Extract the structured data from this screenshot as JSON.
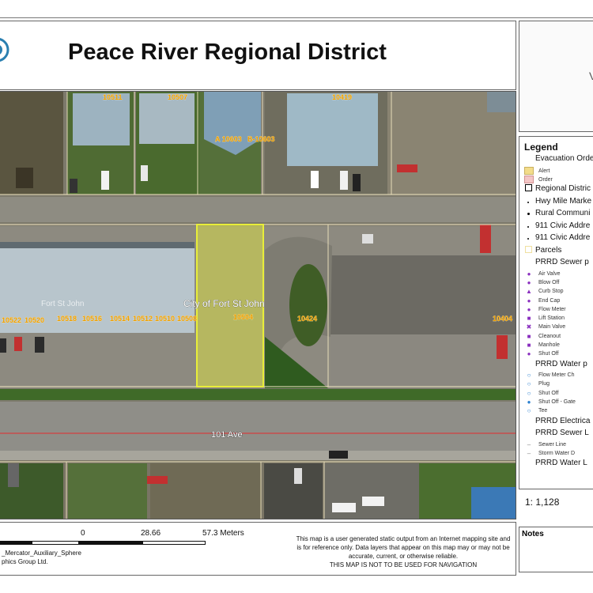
{
  "title": "Peace River Regional District",
  "map": {
    "street_label": "101 Ave",
    "place_label": "City of Fort St John",
    "faint_label": "Fort St John",
    "addresses": [
      "10511",
      "10507",
      "A 10603",
      "B-10603",
      "10419",
      "10522",
      "10520",
      "10518",
      "10516",
      "10514",
      "10512",
      "10510",
      "10508",
      "10504",
      "10424",
      "10404"
    ],
    "highlight_color": "#e8ee3a"
  },
  "legend": {
    "title": "Legend",
    "items": [
      {
        "label": "Evacuation Orde",
        "level": "header"
      },
      {
        "label": "Alert",
        "level": "sub",
        "symbol": "swatch-alert"
      },
      {
        "label": "Order",
        "level": "sub",
        "symbol": "swatch-order"
      },
      {
        "label": "Regional Distric",
        "level": "header",
        "symbol": "box-outline"
      },
      {
        "label": "Hwy Mile Marke",
        "level": "header",
        "symbol": "dot-small"
      },
      {
        "label": "Rural Communi",
        "level": "header",
        "symbol": "dot"
      },
      {
        "label": "911 Civic Addre",
        "level": "header",
        "symbol": "dot-small"
      },
      {
        "label": "911 Civic Addre",
        "level": "header",
        "symbol": "dot-small"
      },
      {
        "label": "Parcels",
        "level": "header",
        "symbol": "box-faint"
      },
      {
        "label": "PRRD Sewer p",
        "level": "header"
      },
      {
        "label": "Air Valve",
        "level": "sub",
        "symbol": "purple-dot"
      },
      {
        "label": "Blow Off",
        "level": "sub",
        "symbol": "purple-dot"
      },
      {
        "label": "Curb Stop",
        "level": "sub",
        "symbol": "purple-triangle"
      },
      {
        "label": "End Cap",
        "level": "sub",
        "symbol": "purple-dot"
      },
      {
        "label": "Flow Meter",
        "level": "sub",
        "symbol": "purple-dot"
      },
      {
        "label": "Lift Station",
        "level": "sub",
        "symbol": "purple-square"
      },
      {
        "label": "Main Valve",
        "level": "sub",
        "symbol": "purple-x"
      },
      {
        "label": "Cleanout",
        "level": "sub",
        "symbol": "purple-square"
      },
      {
        "label": "Manhole",
        "level": "sub",
        "symbol": "purple-square"
      },
      {
        "label": "Shut Off",
        "level": "sub",
        "symbol": "purple-dot"
      },
      {
        "label": "PRRD Water p",
        "level": "header"
      },
      {
        "label": "Flow Meter Ch",
        "level": "sub",
        "symbol": "blue-ring"
      },
      {
        "label": "Plug",
        "level": "sub",
        "symbol": "blue-ring"
      },
      {
        "label": "Shut Off",
        "level": "sub",
        "symbol": "blue-ring"
      },
      {
        "label": "Shut Off - Gate",
        "level": "sub",
        "symbol": "blue-dot"
      },
      {
        "label": "Tee",
        "level": "sub",
        "symbol": "blue-ring"
      },
      {
        "label": "PRRD Electrica",
        "level": "header"
      },
      {
        "label": "PRRD Sewer L",
        "level": "header"
      },
      {
        "label": "Sewer Line",
        "level": "sub",
        "symbol": "dash"
      },
      {
        "label": "Storm Water D",
        "level": "sub",
        "symbol": "dash"
      },
      {
        "label": "PRRD Water L",
        "level": "header"
      }
    ],
    "scale_ratio": "1: 1,128"
  },
  "notes": {
    "label": "Notes"
  },
  "scalebar": {
    "labels": [
      "0",
      "28.66",
      "57.3 Meters"
    ]
  },
  "projection": [
    "_Mercator_Auxiliary_Sphere",
    "phics Group Ltd."
  ],
  "disclaimer": [
    "This map is a user generated static output from an Internet mapping site and",
    "is for reference only. Data layers that appear on this map may or may not be",
    "accurate, current, or otherwise reliable.",
    "THIS MAP IS NOT TO BE USED FOR NAVIGATION"
  ]
}
